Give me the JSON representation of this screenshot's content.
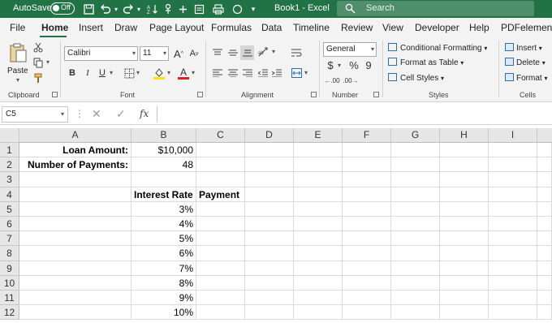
{
  "titlebar": {
    "autosave_label": "AutoSave",
    "toggle_label": "Off",
    "document_title": "Book1  -  Excel",
    "search_placeholder": "Search",
    "bg_color": "#217346"
  },
  "tabs": [
    "File",
    "Home",
    "Insert",
    "Draw",
    "Page Layout",
    "Formulas",
    "Data",
    "Timeline",
    "Review",
    "View",
    "Developer",
    "Help",
    "PDFelement"
  ],
  "active_tab": "Home",
  "ribbon": {
    "clipboard": {
      "paste_label": "Paste",
      "group_label": "Clipboard"
    },
    "font": {
      "font_name": "Calibri",
      "font_size": "11",
      "bold": "B",
      "italic": "I",
      "underline": "U",
      "grow": "A",
      "shrink": "A",
      "group_label": "Font",
      "font_color": "#e02020",
      "fill_color": "#ffe000"
    },
    "alignment": {
      "group_label": "Alignment"
    },
    "number": {
      "format": "General",
      "currency": "$",
      "percent": "%",
      "comma": "9",
      "inc_decimal": ".00",
      "dec_decimal": ".00",
      "group_label": "Number"
    },
    "styles": {
      "conditional": "Conditional Formatting",
      "format_table": "Format as Table",
      "cell_styles": "Cell Styles",
      "group_label": "Styles"
    },
    "cells": {
      "insert": "Insert",
      "delete": "Delete",
      "format": "Format",
      "group_label": "Cells"
    }
  },
  "formula_bar": {
    "name_box": "C5",
    "fx": "fx",
    "formula": ""
  },
  "columns": [
    "A",
    "B",
    "C",
    "D",
    "E",
    "F",
    "G",
    "H",
    "I"
  ],
  "rows": [
    "1",
    "2",
    "3",
    "4",
    "5",
    "6",
    "7",
    "8",
    "9",
    "10",
    "11",
    "12"
  ],
  "cells": {
    "A1": "Loan Amount:",
    "B1": "$10,000",
    "A2": "Number of Payments:",
    "B2": "48",
    "B4": "Interest Rate",
    "C4": "Payment",
    "B5": "3%",
    "B6": "4%",
    "B7": "5%",
    "B8": "6%",
    "B9": "7%",
    "B10": "8%",
    "B11": "9%",
    "B12": "10%"
  }
}
